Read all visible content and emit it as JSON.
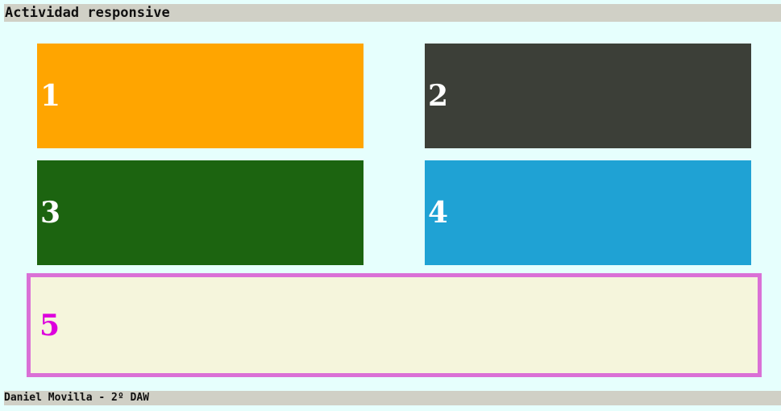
{
  "header": {
    "title": "Actividad responsive"
  },
  "boxes": [
    {
      "label": "1",
      "color": "#ffa500"
    },
    {
      "label": "2",
      "color": "#3c3f38"
    },
    {
      "label": "3",
      "color": "#1c6410"
    },
    {
      "label": "4",
      "color": "#1fa2d4"
    },
    {
      "label": "5",
      "color": "#f5f5dc",
      "border_color": "#da70d6",
      "text_color": "#dd00dd"
    }
  ],
  "footer": {
    "text": "Daniel Movilla - 2º DAW"
  }
}
